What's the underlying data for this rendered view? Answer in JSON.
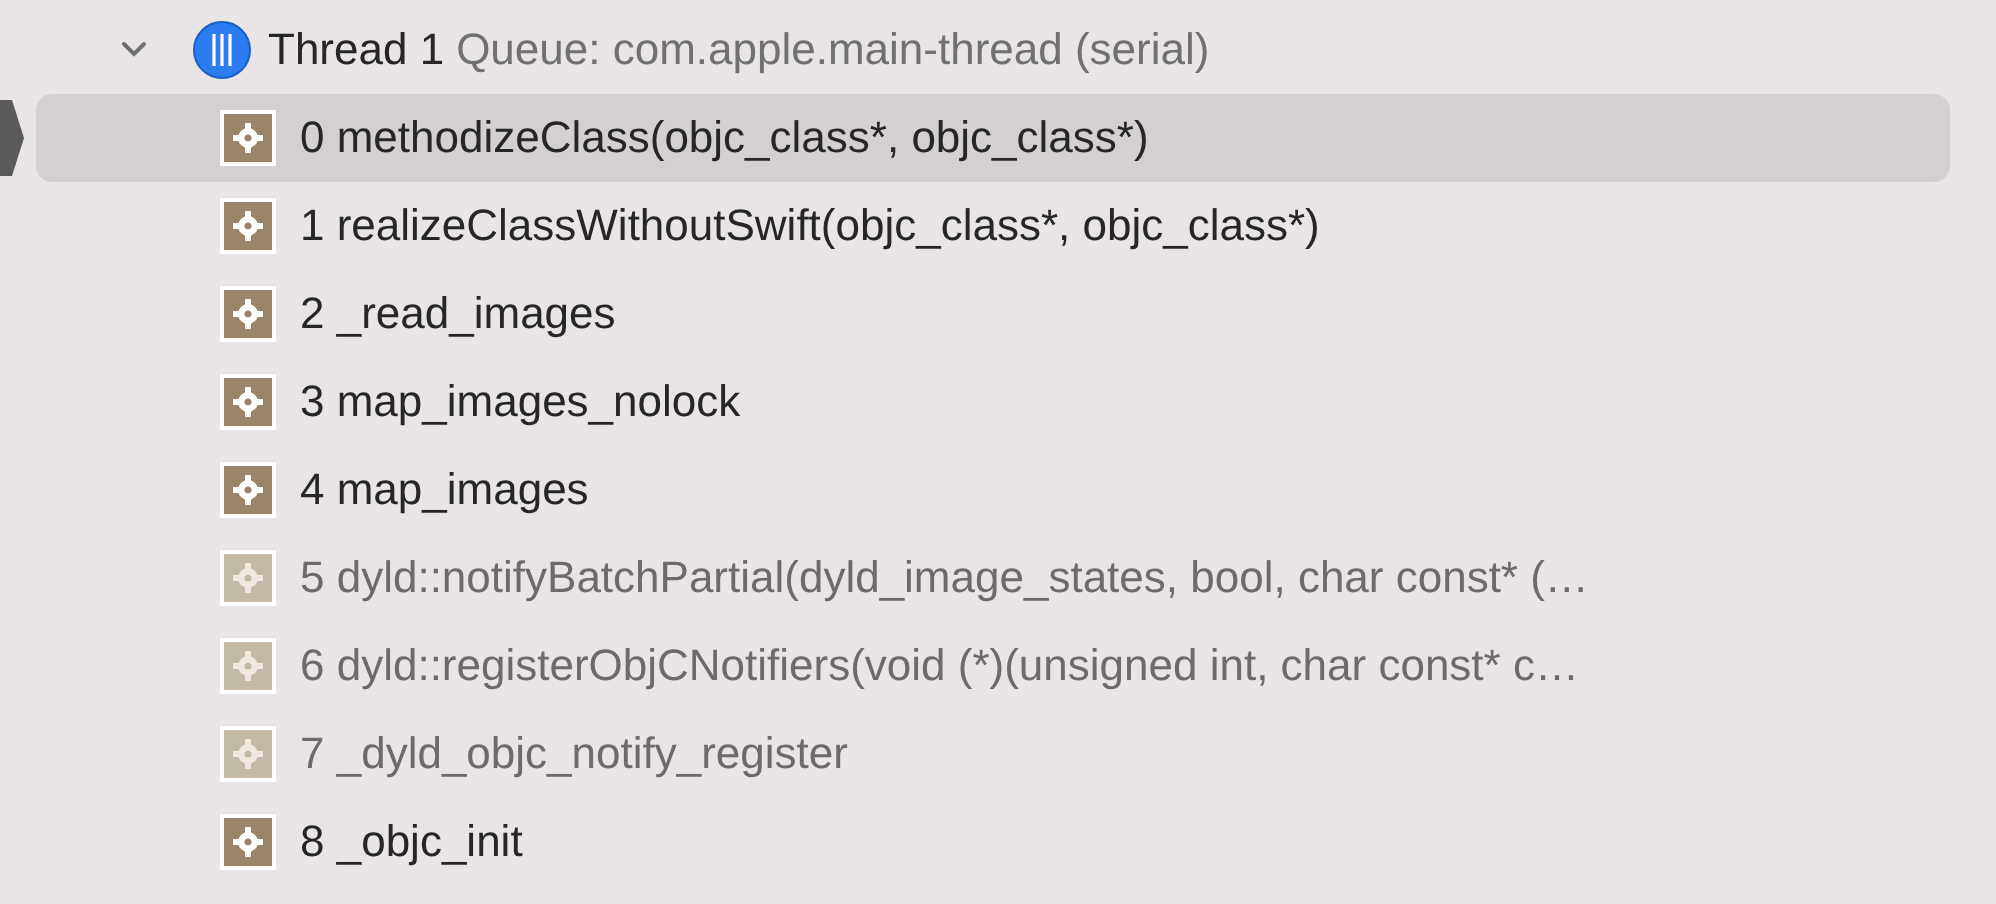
{
  "thread": {
    "expanded": true,
    "name": "Thread 1",
    "queue": "Queue: com.apple.main-thread (serial)"
  },
  "frames": [
    {
      "label": "0 methodizeClass(objc_class*, objc_class*)",
      "selected": true,
      "dimmed": false
    },
    {
      "label": "1 realizeClassWithoutSwift(objc_class*, objc_class*)",
      "selected": false,
      "dimmed": false
    },
    {
      "label": "2 _read_images",
      "selected": false,
      "dimmed": false
    },
    {
      "label": "3 map_images_nolock",
      "selected": false,
      "dimmed": false
    },
    {
      "label": "4 map_images",
      "selected": false,
      "dimmed": false
    },
    {
      "label": "5 dyld::notifyBatchPartial(dyld_image_states, bool, char const* (…",
      "selected": false,
      "dimmed": true
    },
    {
      "label": "6 dyld::registerObjCNotifiers(void (*)(unsigned int, char const* c…",
      "selected": false,
      "dimmed": true
    },
    {
      "label": "7 _dyld_objc_notify_register",
      "selected": false,
      "dimmed": true
    },
    {
      "label": "8 _objc_init",
      "selected": false,
      "dimmed": false
    }
  ]
}
